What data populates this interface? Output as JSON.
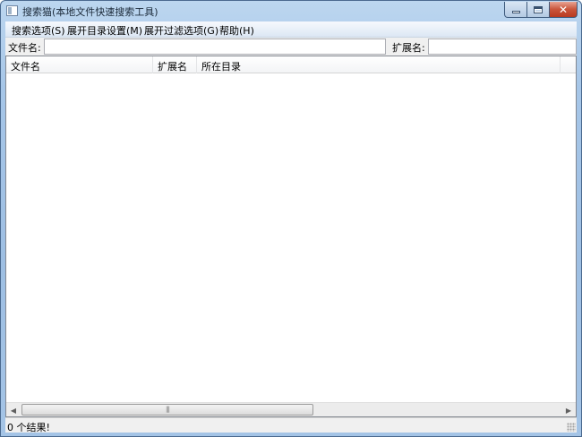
{
  "window": {
    "title": "搜索猫(本地文件快速搜索工具)",
    "icon": "app-window-icon",
    "controls": {
      "minimize": "minimize-icon",
      "maximize": "maximize-icon",
      "close": "✕"
    }
  },
  "menu": {
    "items": [
      {
        "label": "搜索选项(S)"
      },
      {
        "label": "展开目录设置(M)"
      },
      {
        "label": "展开过滤选项(G)"
      },
      {
        "label": "帮助(H)"
      }
    ]
  },
  "search": {
    "filename_label": "文件名:",
    "filename_value": "",
    "extension_label": "扩展名:",
    "extension_value": ""
  },
  "results": {
    "columns": [
      {
        "label": "文件名"
      },
      {
        "label": "扩展名"
      },
      {
        "label": "所在目录"
      }
    ],
    "rows": []
  },
  "scrollbar": {
    "left_arrow": "◀",
    "right_arrow": "▶",
    "grip": "|||"
  },
  "status": {
    "text": "0 个结果!"
  },
  "colors": {
    "title_bar": "#a6c6e8",
    "close_button": "#c9543a",
    "client_bg": "#f0f0f0"
  }
}
